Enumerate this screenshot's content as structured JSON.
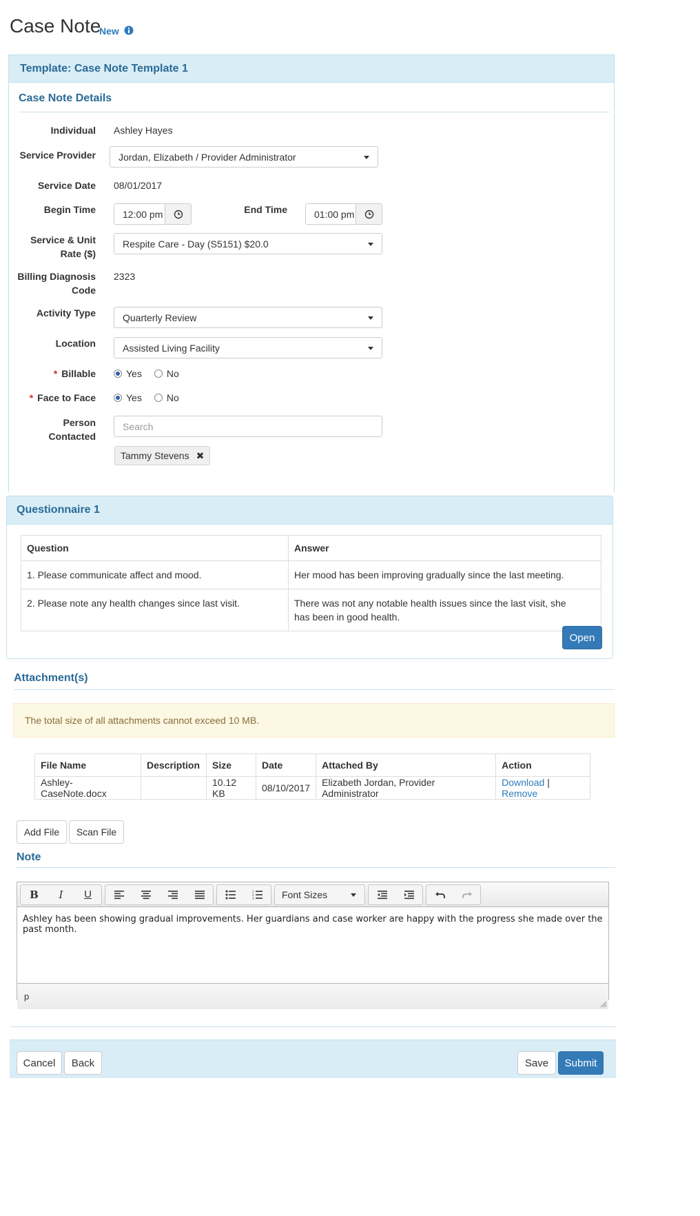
{
  "page": {
    "title": "Case Note",
    "badge": "New"
  },
  "template": {
    "header": "Template: Case Note Template 1"
  },
  "details": {
    "title": "Case Note Details",
    "individual_label": "Individual",
    "individual_value": "Ashley Hayes",
    "service_provider_label": "Service Provider",
    "service_provider_value": "Jordan, Elizabeth / Provider Administrator",
    "service_date_label": "Service Date",
    "service_date_value": "08/01/2017",
    "begin_time_label": "Begin Time",
    "begin_time_value": "12:00 pm",
    "end_time_label": "End Time",
    "end_time_value": "01:00 pm",
    "service_rate_label_1": "Service & Unit",
    "service_rate_label_2": "Rate ($)",
    "service_rate_value": "Respite Care - Day (S5151) $20.0",
    "billing_label_1": "Billing Diagnosis",
    "billing_label_2": "Code",
    "billing_value": "2323",
    "activity_label": "Activity Type",
    "activity_value": "Quarterly Review",
    "location_label": "Location",
    "location_value": "Assisted Living Facility",
    "billable_label": "Billable",
    "face_label": "Face to Face",
    "yes": "Yes",
    "no": "No",
    "billable_selected": "Yes",
    "face_selected": "Yes",
    "person_label": "Person Contacted",
    "person_placeholder": "Search",
    "person_tag": "Tammy Stevens"
  },
  "questionnaire": {
    "title": "Questionnaire 1",
    "headers": [
      "Question",
      "Answer"
    ],
    "rows": [
      {
        "question": "1. Please communicate affect and mood.",
        "answer": "Her mood has been improving gradually since the last meeting."
      },
      {
        "question": "2. Please note any health changes since last visit.",
        "answer_line1": "There was not any notable health issues since the last visit, she",
        "answer_line2": "has been in good health."
      }
    ],
    "open_button": "Open"
  },
  "attachments": {
    "title": "Attachment(s)",
    "alert": "The total size of all attachments cannot exceed 10 MB.",
    "headers": [
      "File Name",
      "Description",
      "Size",
      "Date",
      "Attached By",
      "Action"
    ],
    "rows": [
      {
        "file": "Ashley-CaseNote.docx",
        "description": "",
        "size": "10.12 KB",
        "date": "08/10/2017",
        "by": "Elizabeth Jordan, Provider Administrator",
        "download": "Download",
        "sep": "|",
        "remove": "Remove"
      }
    ],
    "add_button": "Add File",
    "scan_button": "Scan File"
  },
  "note": {
    "title": "Note",
    "font_sizes": "Font Sizes",
    "body": "Ashley has been showing gradual improvements. Her guardians and case worker are happy with the progress she made over the past month.",
    "status_path": "p"
  },
  "footer": {
    "cancel": "Cancel",
    "back": "Back",
    "save": "Save",
    "submit": "Submit"
  },
  "colors": {
    "accent": "#337ab7",
    "panel_header": "#d9edf7",
    "heading_text": "#2a6a96",
    "alert_bg": "#fcf8e3"
  }
}
